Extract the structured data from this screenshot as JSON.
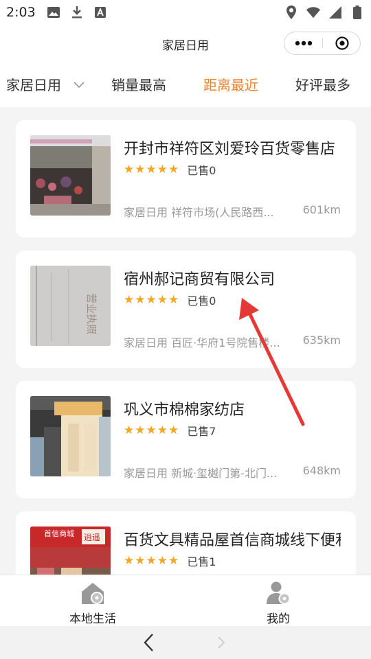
{
  "status_bar": {
    "time": "2:03",
    "left_icons": [
      "image-icon",
      "download-icon",
      "font-icon"
    ],
    "right_icons": [
      "location-icon",
      "wifi-icon",
      "signal-icon",
      "battery-icon"
    ]
  },
  "header": {
    "title": "家居日用",
    "more_icon": "more-dots-icon",
    "close_icon": "target-icon"
  },
  "tabs": [
    {
      "label": "家居日用",
      "active": false,
      "has_dropdown": true
    },
    {
      "label": "销量最高",
      "active": false
    },
    {
      "label": "距离最近",
      "active": true
    },
    {
      "label": "好评最多",
      "active": false
    }
  ],
  "shops": [
    {
      "name": "开封市祥符区刘爱玲百货零售店",
      "stars": 5,
      "sold": "已售0",
      "category_address": "家居日用 祥符市场(人民路西...",
      "distance": "601km"
    },
    {
      "name": "宿州郝记商贸有限公司",
      "stars": 5,
      "sold": "已售0",
      "category_address": "家居日用 百匠·华府1号院售楼...",
      "distance": "635km"
    },
    {
      "name": "巩义市棉棉家纺店",
      "stars": 5,
      "sold": "已售7",
      "category_address": "家居日用 新城·玺樾门第-北门...",
      "distance": "648km"
    },
    {
      "name": "百货文具精品屋首信商城线下便利店",
      "stars": 5,
      "sold": "已售1",
      "category_address": "",
      "distance": ""
    }
  ],
  "thumb_text": {
    "license": "营业执照",
    "store_sign": "首信商城",
    "store_sign2": "逍遥"
  },
  "bottom_nav": [
    {
      "label": "本地生活",
      "icon": "home-icon"
    },
    {
      "label": "我的",
      "icon": "user-icon"
    }
  ],
  "system_nav": {
    "back_icon": "back-arrow-icon",
    "forward_icon": "forward-arrow-icon"
  },
  "colors": {
    "accent": "#f08330",
    "star": "#f5a623",
    "arrow": "#e53935"
  }
}
